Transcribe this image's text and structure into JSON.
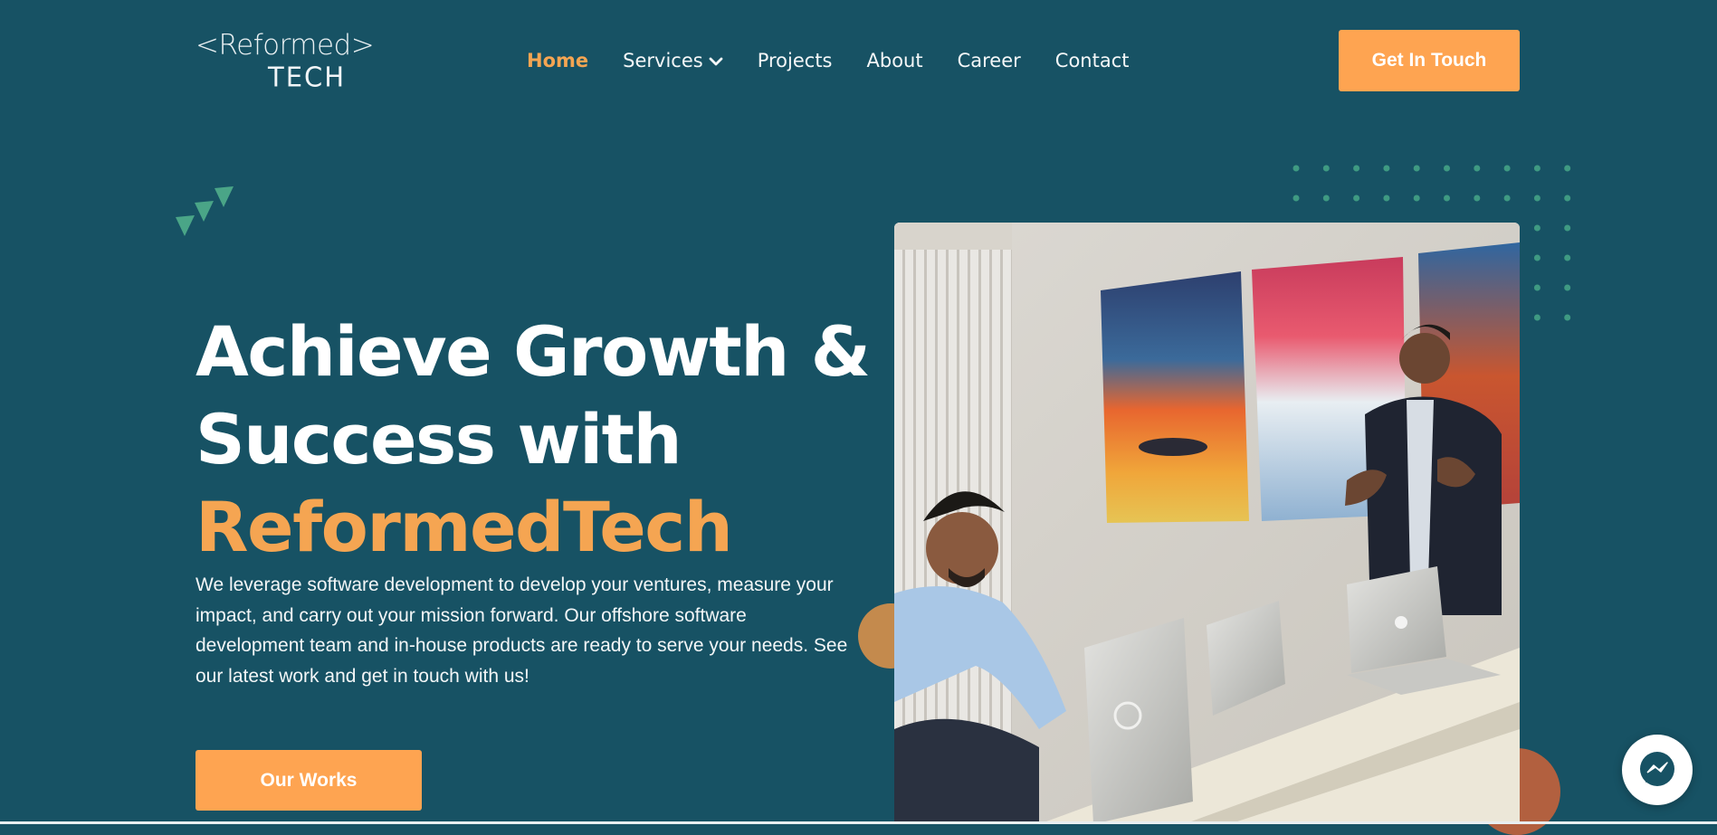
{
  "header": {
    "logo": {
      "line1": "<Reformed>",
      "line2": "TECH"
    },
    "nav": [
      {
        "label": "Home",
        "active": true
      },
      {
        "label": "Services",
        "has_dropdown": true
      },
      {
        "label": "Projects"
      },
      {
        "label": "About"
      },
      {
        "label": "Career"
      },
      {
        "label": "Contact"
      }
    ],
    "cta_label": "Get In Touch"
  },
  "hero": {
    "headline_line1": "Achieve Growth &",
    "headline_line2": "Success with",
    "headline_accent": "ReformedTech",
    "description": "We leverage software development to develop your ventures, measure your impact, and carry out your mission forward. Our offshore software development team and in-house products are ready to serve your needs. See our latest work and get in touch with us!",
    "button_label": "Our Works",
    "image_icon": "team-meeting-photo"
  },
  "messenger_icon": "messenger-icon",
  "colors": {
    "background": "#175264",
    "accent": "#f5a552",
    "button": "#fea451",
    "triangle": "#4aa587",
    "dot": "#3f9a82",
    "circle_gold": "#c48a4d",
    "circle_rust": "#b2603f"
  }
}
